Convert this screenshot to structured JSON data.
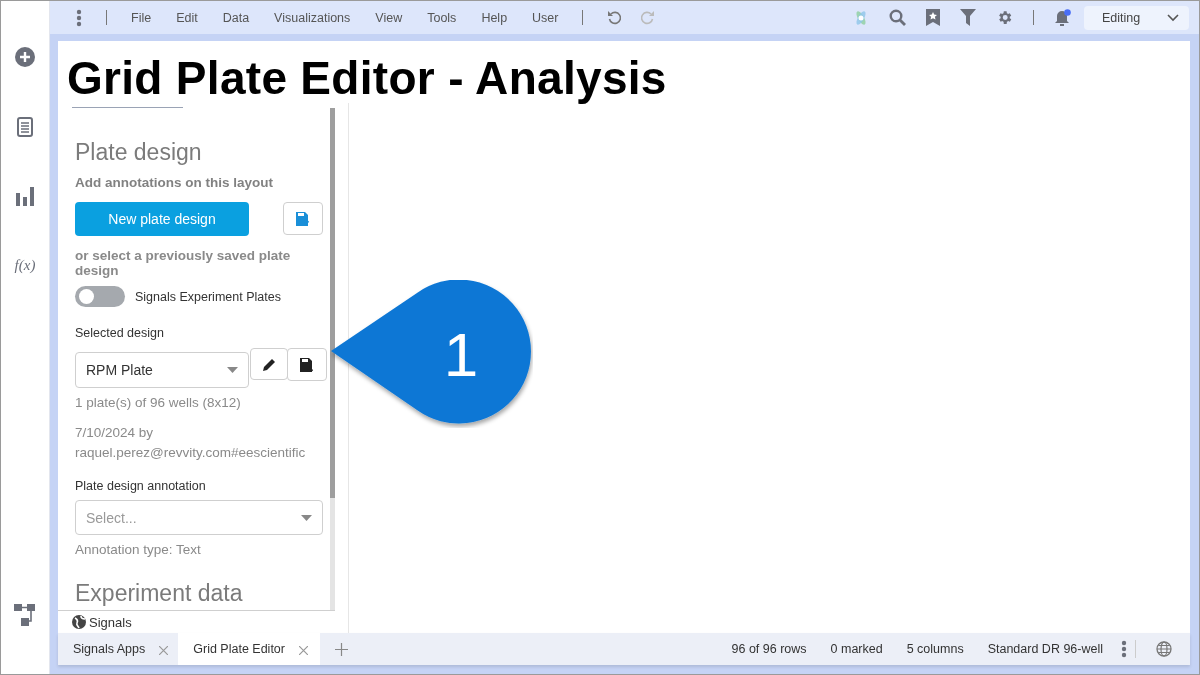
{
  "toolbar": {
    "menu": [
      "File",
      "Edit",
      "Data",
      "Visualizations",
      "View",
      "Tools",
      "Help",
      "User"
    ],
    "mode": "Editing"
  },
  "rail": {
    "formula": "f(x)"
  },
  "page_title": "Grid Plate Editor - Analysis",
  "panel": {
    "heading": "Plate design",
    "subtitle": "Add annotations on this layout",
    "new_button": "New plate design",
    "or_text": "or select a previously saved plate design",
    "toggle": {
      "label": "Signals Experiment Plates",
      "on": false
    },
    "selected_label": "Selected design",
    "selected_value": "RPM Plate",
    "plate_info": "1 plate(s) of 96 wells (8x12)",
    "created": "7/10/2024 by raquel.perez@revvity.com#eescientific",
    "annotation_label": "Plate design annotation",
    "annotation_placeholder": "Select...",
    "annotation_type": "Annotation type: Text",
    "next_heading": "Experiment data",
    "footer": "Signals"
  },
  "callout": "1",
  "tabs": [
    {
      "label": "Signals Apps",
      "selected": false
    },
    {
      "label": "Grid Plate Editor",
      "selected": true
    }
  ],
  "status_bar": [
    "96 of 96 rows",
    "0 marked",
    "5 columns",
    "Standard DR 96-well"
  ]
}
